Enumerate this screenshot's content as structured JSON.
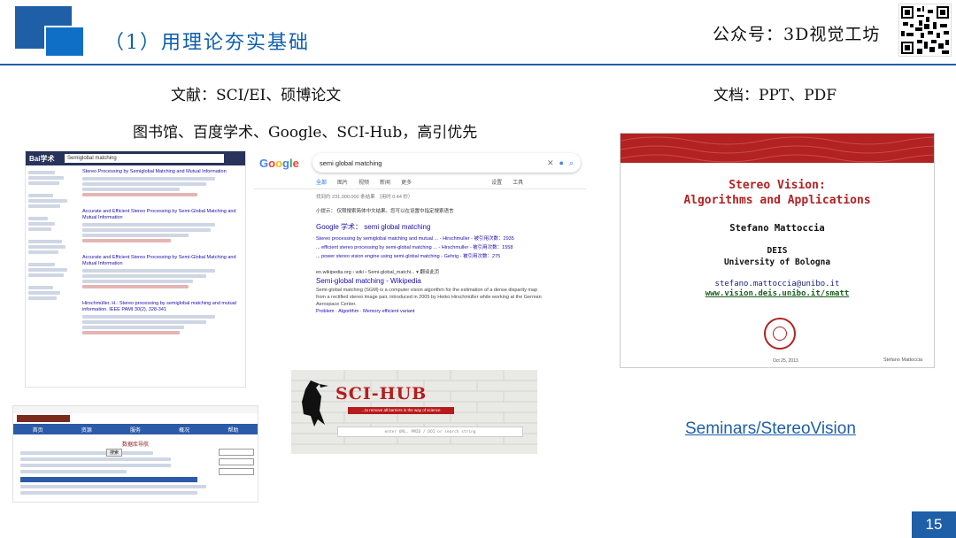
{
  "slide": {
    "title": "（1）用理论夯实基础",
    "brand": "公众号：3D视觉工坊",
    "label_literature": "文献：SCI/EI、硕博论文",
    "label_docs": "文档：PPT、PDF",
    "label_sources": "图书馆、百度学术、Google、SCI-Hub，高引优先",
    "seminar_link": "Seminars/StereoVision",
    "page_number": "15"
  },
  "baidu": {
    "logo": "Bai学术",
    "query": "Semiglobal matching",
    "results": [
      {
        "title": "Stereo Processing by Semiglobal Matching and Mutual Information"
      },
      {
        "title": "Accurate and Efficient Stereo Processing by Semi-Global Matching and Mutual Information"
      },
      {
        "title": "Accurate and Efficient Stereo Processing by Semi-Global Matching and Mutual Information"
      },
      {
        "title": "Hirschmüller, H.: Stereo processing by semiglobal matching and mutual information. IEEE PAMI 30(2), 328-341"
      }
    ]
  },
  "google": {
    "logo": "Google",
    "query": "semi global matching",
    "tabs": [
      "全部",
      "图片",
      "视频",
      "新闻",
      "更多"
    ],
    "tools": [
      "设置",
      "工具"
    ],
    "stats": "找到约 231,000,000 条结果 （用时 0.44 秒）",
    "hint": "小提示： 仅限搜索简体中文结果。您可以在设置中指定搜索语言",
    "scholar_title": "Google 学术： semi global matching",
    "scholar_lines": [
      "Stereo processing by semiglobal matching and mutual ... - Hirschmuller - 被引用次数：2935",
      "... efficient stereo processing by semi-global matching ... - Hirschmuller - 被引用次数：1558",
      "... power stereo vision engine using semi-global matching - Gehrig - 被引用次数：275"
    ],
    "wiki_url": "en.wikipedia.org › wiki › Semi-global_matchi... ▾ 翻译此页",
    "wiki_title": "Semi-global matching - Wikipedia",
    "wiki_snippet": "Semi-global matching (SGM) is a computer vision algorithm for the estimation of a dense disparity map from a rectified stereo image pair, introduced in 2005 by Heiko Hirschmüller while working at the German Aerospace Center.",
    "wiki_links": "Problem · Algorithm · Memory efficient variant"
  },
  "library": {
    "nav": [
      "首页",
      "资源",
      "服务",
      "概况",
      "帮助"
    ],
    "heading": "数据库导航",
    "search_btn": "搜索"
  },
  "scihub": {
    "logo": "SCI-HUB",
    "tagline": "...to remove all barriers in the way of science",
    "placeholder": "enter URL, PMID / DOI or search string"
  },
  "pdf": {
    "title": "Stereo Vision:",
    "subtitle": "Algorithms and Applications",
    "author": "Stefano Mattoccia",
    "dept": "DEIS",
    "university": "University of Bologna",
    "email": "stefano.mattoccia@unibo.it",
    "url": "www.vision.deis.unibo.it/smatt",
    "date": "Oct 25, 2013",
    "footer_author": "Stefano Mattoccia"
  },
  "colors": {
    "accent": "#1f5fa8",
    "pdf_red": "#b22222",
    "scihub_red": "#b71c1c"
  }
}
